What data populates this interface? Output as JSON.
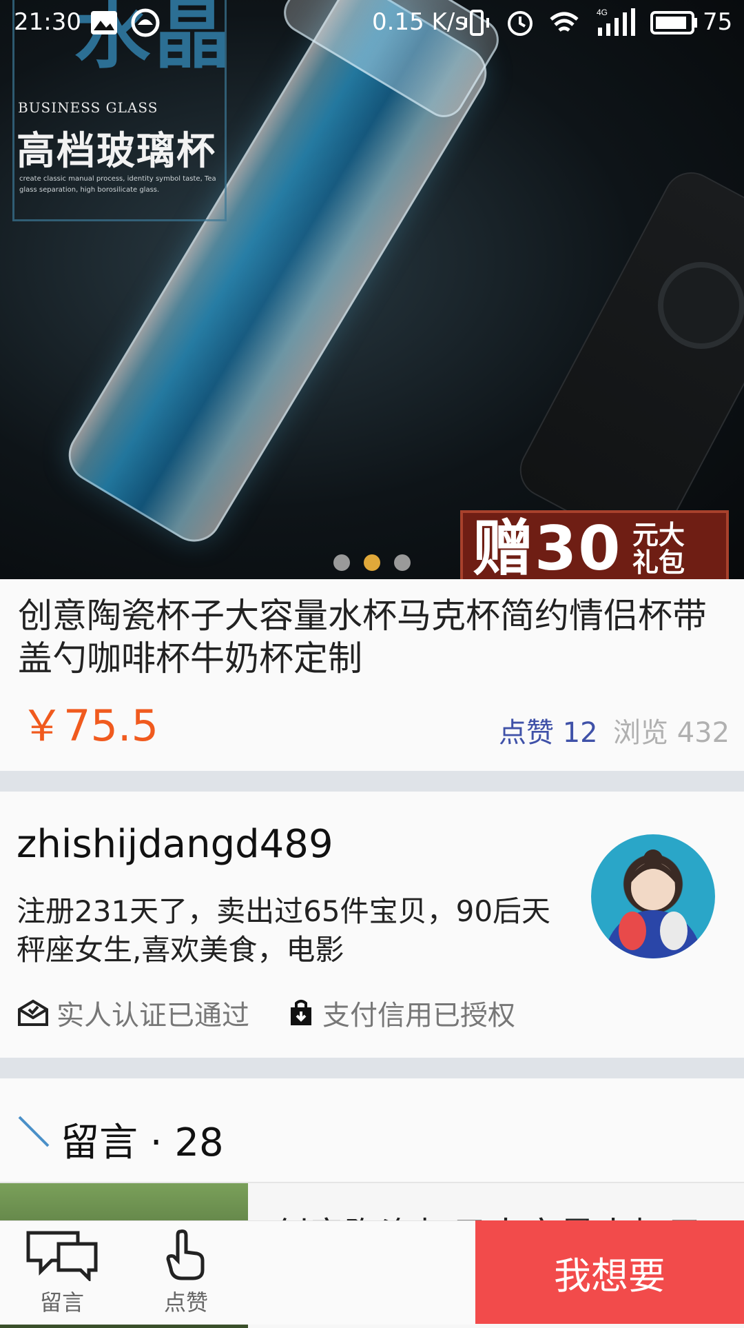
{
  "status_bar": {
    "time": "21:30",
    "net_speed": "0.15 K/s",
    "battery": "75"
  },
  "banner": {
    "brand_big": "水晶",
    "brand_en": "BUSINESS GLASS",
    "brand_cn": "高档玻璃杯",
    "brand_small": "create classic manual process, identity symbol taste, Tea glass separation, high borosilicate glass.",
    "gift_main": "赠30",
    "gift_unit": "元大礼包",
    "dots": [
      "inactive",
      "active",
      "inactive"
    ]
  },
  "product": {
    "title": "创意陶瓷杯子大容量水杯马克杯简约情侣杯带盖勺咖啡杯牛奶杯定制",
    "price": "￥75.5",
    "likes": "点赞 12",
    "views": "浏览 432"
  },
  "seller": {
    "name": "zhishijdangd489",
    "description": "注册231天了，卖出过65件宝贝，90后天秤座女生,喜欢美食，电影",
    "badge_identity": "实人认证已通过",
    "badge_credit": "支付信用已授权"
  },
  "comments": {
    "title": "留言 · 28",
    "preview_text": "创意陶瓷杯子大容量水杯子"
  },
  "bottom_bar": {
    "comment_label": "留言",
    "like_label": "点赞",
    "want_label": "我想要"
  },
  "colors": {
    "price": "#f05a1e",
    "likes": "#3f51a8",
    "want_button": "#f24b4b",
    "active_dot": "#e0a83a"
  }
}
